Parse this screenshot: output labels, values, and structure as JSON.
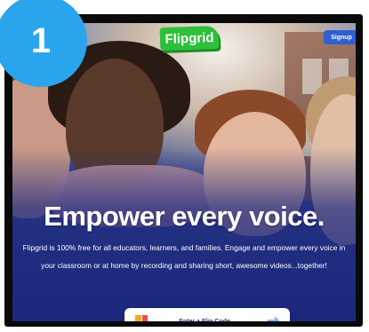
{
  "badge": {
    "number": "1"
  },
  "header": {
    "logo_text": "Flipgrid",
    "signup_label": "Signup"
  },
  "hero": {
    "headline": "Empower every voice.",
    "description": "Flipgrid is 100% free for all educators, learners, and families. Engage and empower every voice in your classroom or at home by recording and sharing short, awesome videos...together!"
  },
  "code_entry": {
    "label": "Enter a Flip Code",
    "icon": "grid-icon",
    "arrow_icon": "arrow-right-icon"
  },
  "colors": {
    "badge": "#2aa4ec",
    "logo": "#2fbf3a",
    "signup": "#2f5fd0",
    "hero_overlay": "#1c2a72"
  }
}
